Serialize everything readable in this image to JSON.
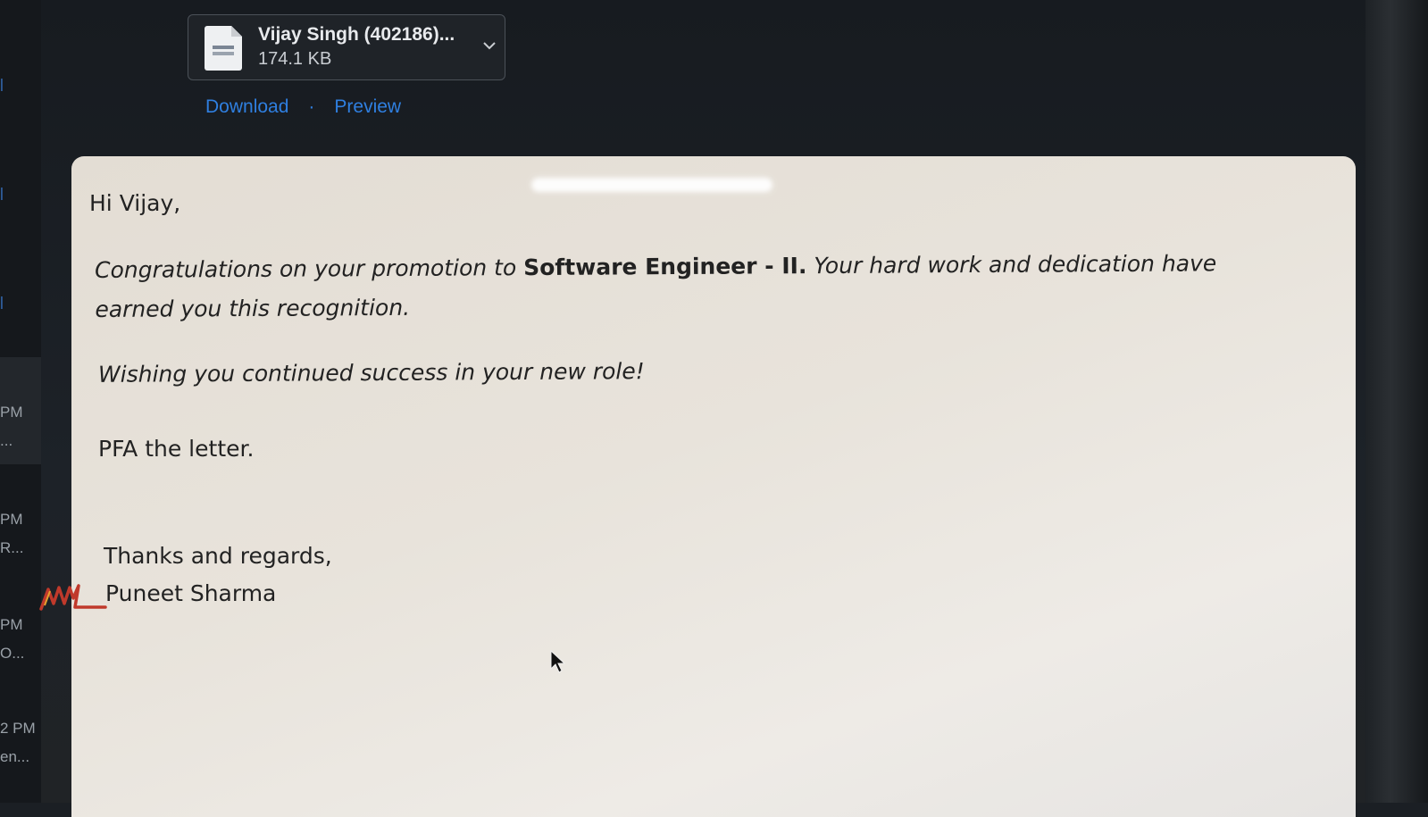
{
  "sidebar": {
    "times": [
      "PM",
      "PM",
      "PM",
      "2 PM"
    ],
    "snippets": [
      "...",
      "R...",
      "O...",
      "en..."
    ]
  },
  "attachment": {
    "file_name": "Vijay Singh (402186)...",
    "file_size": "174.1 KB",
    "file_icon": "document-icon",
    "dropdown_icon": "chevron-down-icon"
  },
  "actions": {
    "download_label": "Download",
    "separator": "·",
    "preview_label": "Preview"
  },
  "email": {
    "greeting": "Hi Vijay,",
    "congrats_prefix": "Congratulations on your promotion to ",
    "congrats_role": "Software Engineer - II.",
    "congrats_suffix": " Your hard work and dedication have earned you this recognition.",
    "wish": "Wishing you continued success in your new role!",
    "pfa": "PFA the letter.",
    "closing": "Thanks and regards,",
    "sender": "Puneet Sharma"
  },
  "colors": {
    "link": "#2f7fe0",
    "panel_bg": "#e8e3db",
    "dark_bg": "#1b1f24",
    "signature": "#c0392b"
  }
}
